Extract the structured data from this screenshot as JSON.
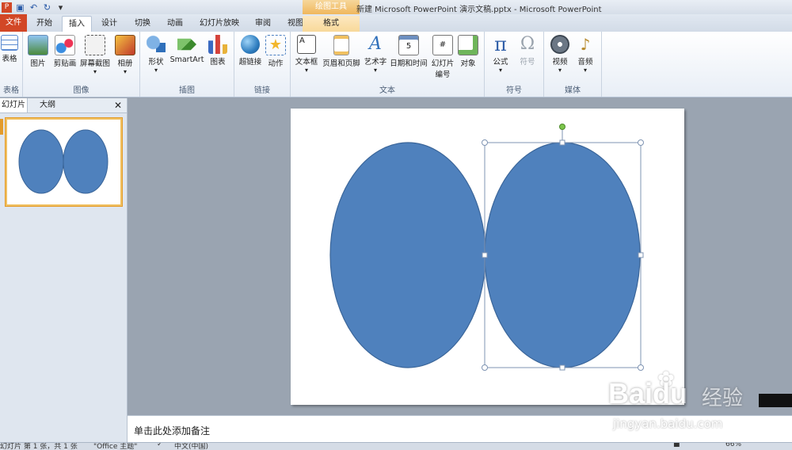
{
  "window": {
    "title": "新建 Microsoft PowerPoint 演示文稿.pptx - Microsoft PowerPoint",
    "context_tool": "绘图工具"
  },
  "qat": {
    "icons": [
      "ppt-logo-icon",
      "save-icon",
      "undo-icon",
      "redo-icon",
      "customize-icon"
    ]
  },
  "tabs": {
    "file": "文件",
    "home": "开始",
    "insert": "插入",
    "design": "设计",
    "transitions": "切换",
    "animations": "动画",
    "slideshow": "幻灯片放映",
    "review": "审阅",
    "view": "视图",
    "format": "格式"
  },
  "ribbon": {
    "groups": {
      "table": "表格",
      "images": "图像",
      "illustrations": "插图",
      "links": "链接",
      "text": "文本",
      "symbols": "符号",
      "media": "媒体"
    },
    "buttons": {
      "table": "表格",
      "picture": "图片",
      "clipart": "剪贴画",
      "screenshot": "屏幕截图",
      "album": "相册",
      "shapes": "形状",
      "smartart": "SmartArt",
      "chart": "图表",
      "hyperlink": "超链接",
      "action": "动作",
      "textbox": "文本框",
      "header_footer": "页眉和页脚",
      "wordart": "艺术字",
      "datetime": "日期和时间",
      "slide_number_1": "幻灯片",
      "slide_number_2": "编号",
      "object": "对象",
      "equation": "公式",
      "symbol": "符号",
      "video": "视频",
      "audio": "音频"
    },
    "glyphs": {
      "equation": "π",
      "symbol": "Ω",
      "wordart": "A",
      "chevron": "▾"
    }
  },
  "left_pane": {
    "tab_slides": "幻灯片",
    "tab_outline": "大纲",
    "close": "✕"
  },
  "notes": {
    "placeholder": "单击此处添加备注"
  },
  "status": {
    "slide_info": "幻灯片 第 1 张，共 1 张",
    "theme": "\"Office 主题\"",
    "language": "中文(中国)",
    "zoom": "66%"
  },
  "watermark": {
    "brand": "Bai",
    "brand2": "du",
    "jingyan": "经验",
    "url": "jingyan.baidu.com"
  },
  "colors": {
    "shape_fill": "#4f81bd",
    "shape_stroke": "#3a6599",
    "file_tab": "#d24726",
    "selection": "#7f94b3",
    "rotate_handle": "#7cc54b"
  }
}
